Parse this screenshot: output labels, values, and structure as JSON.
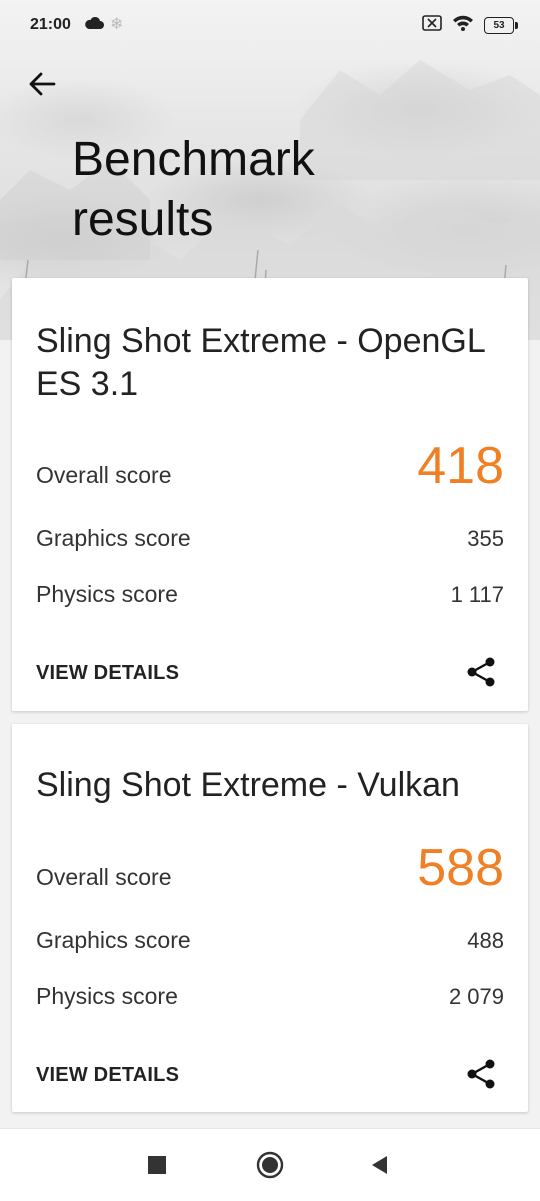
{
  "status_bar": {
    "time": "21:00",
    "battery": "53",
    "icons": [
      "cloud-icon",
      "snowflake-icon",
      "no-sim-icon",
      "wifi-icon",
      "battery-icon"
    ]
  },
  "header": {
    "title": "Benchmark results",
    "back_icon": "arrow-left-icon"
  },
  "results": [
    {
      "title": "Sling Shot Extreme - OpenGL ES 3.1",
      "overall_label": "Overall score",
      "overall_value": "418",
      "graphics_label": "Graphics score",
      "graphics_value": "355",
      "physics_label": "Physics score",
      "physics_value": "1 117",
      "details_label": "VIEW DETAILS"
    },
    {
      "title": "Sling Shot Extreme - Vulkan",
      "overall_label": "Overall score",
      "overall_value": "588",
      "graphics_label": "Graphics score",
      "graphics_value": "488",
      "physics_label": "Physics score",
      "physics_value": "2 079",
      "details_label": "VIEW DETAILS"
    }
  ],
  "colors": {
    "accent": "#f08026",
    "background": "#f2f2f2"
  },
  "nav_bar": [
    "recents-square-icon",
    "home-circle-icon",
    "back-triangle-icon"
  ]
}
